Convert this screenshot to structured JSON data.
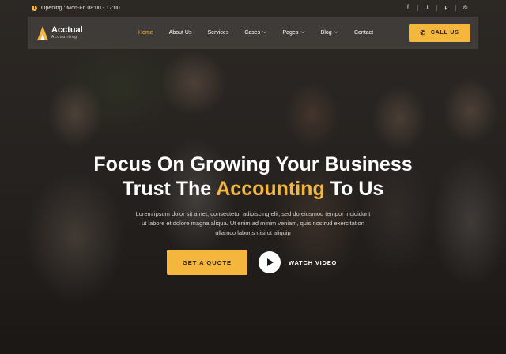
{
  "topbar": {
    "opening_text": "Opening : Mon-Fri 08:00 - 17:00",
    "socials": [
      {
        "icon": "facebook-icon",
        "glyph": "f"
      },
      {
        "icon": "twitter-icon",
        "glyph": "t"
      },
      {
        "icon": "pinterest-icon",
        "glyph": "p"
      },
      {
        "icon": "instagram-icon",
        "glyph": "◎"
      }
    ]
  },
  "logo": {
    "name": "Acctual",
    "tagline": "Accounting"
  },
  "nav": {
    "items": [
      {
        "label": "Home",
        "active": true,
        "dropdown": false
      },
      {
        "label": "About Us",
        "active": false,
        "dropdown": false
      },
      {
        "label": "Services",
        "active": false,
        "dropdown": false
      },
      {
        "label": "Cases",
        "active": false,
        "dropdown": true
      },
      {
        "label": "Pages",
        "active": false,
        "dropdown": true
      },
      {
        "label": "Blog",
        "active": false,
        "dropdown": true
      },
      {
        "label": "Contact",
        "active": false,
        "dropdown": false
      }
    ],
    "call_label": "CALL US"
  },
  "hero": {
    "title_line1": "Focus On Growing Your Business",
    "title_line2_pre": "Trust The ",
    "title_line2_accent": "Accounting",
    "title_line2_post": " To Us",
    "description": "Lorem ipsum dolor sit amet, consectetur adipiscing elit, sed do eiusmod tempor incididunt ut labore et dolore magna aliqua. Ut enim ad minim veniam, quis nostrud exercitation ullamco laboris nisi ut aliquip",
    "quote_label": "GET A QUOTE",
    "watch_label": "WATCH VIDEO"
  },
  "colors": {
    "accent": "#f4b63c",
    "dark": "#2a2319"
  }
}
